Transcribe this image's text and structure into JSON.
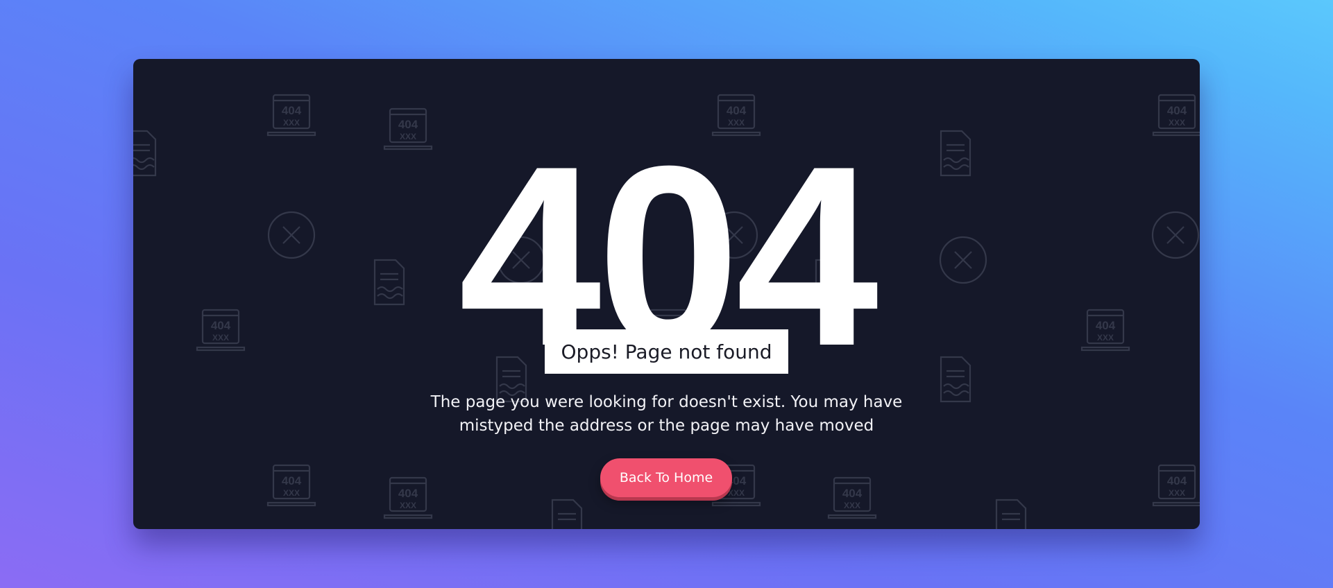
{
  "error_page": {
    "code": "404",
    "title": "Opps! Page not found",
    "message": "The page you were looking for doesn't exist. You may have mistyped the address or the page may have moved",
    "button_label": "Back To Home",
    "icon_text": "404",
    "icon_marks": "XXX"
  },
  "colors": {
    "background_start": "#8b6cf4",
    "background_end": "#5bc8fc",
    "card": "#151829",
    "button": "#f0506e",
    "text": "#ffffff"
  },
  "icons": {
    "pattern": [
      "laptop-404-icon",
      "document-icon",
      "close-circle-icon"
    ]
  }
}
